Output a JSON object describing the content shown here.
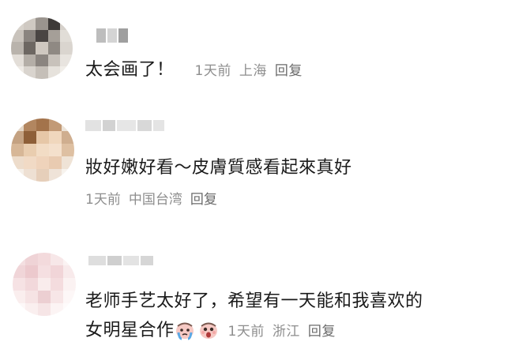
{
  "comments": [
    {
      "text": "太会画了！",
      "time": "1天前",
      "location": "上海",
      "reply": "回复"
    },
    {
      "text": "妝好嫩好看～皮膚質感看起來真好",
      "time": "1天前",
      "location": "中国台湾",
      "reply": "回复"
    },
    {
      "text_line1": "老师手艺太好了，希望有一天能和我喜欢的",
      "text_line2": "女明星合作",
      "emojis": [
        "crying-emoji",
        "shocked-emoji"
      ],
      "time": "1天前",
      "location": "浙江",
      "reply": "回复"
    }
  ]
}
